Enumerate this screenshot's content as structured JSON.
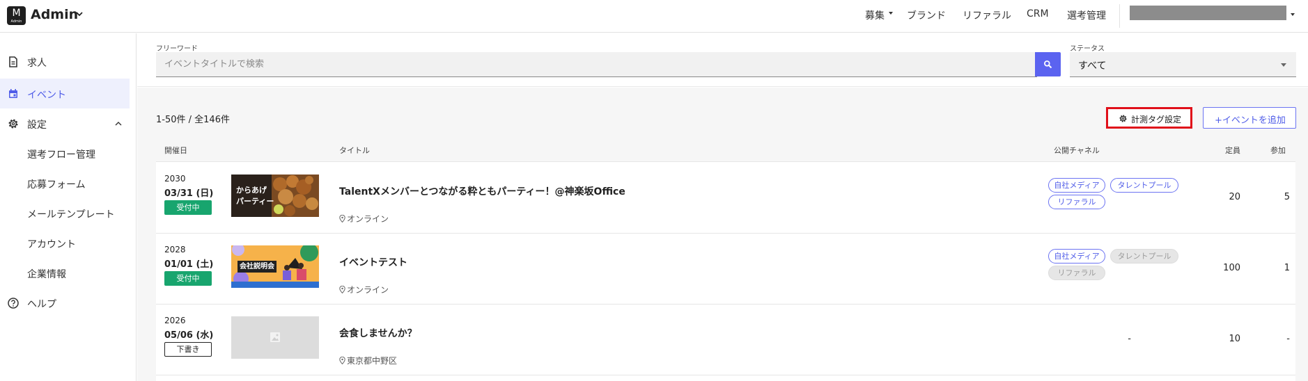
{
  "app": {
    "logo_letter": "M",
    "logo_sub": "Admin",
    "title": "Admin"
  },
  "topnav": {
    "items": [
      "募集",
      "ブランド",
      "リファラル",
      "CRM",
      "選考管理"
    ]
  },
  "sidebar": {
    "items": [
      {
        "label": "求人",
        "icon": "document-icon"
      },
      {
        "label": "イベント",
        "icon": "calendar-icon"
      },
      {
        "label": "設定",
        "icon": "gear-icon"
      }
    ],
    "sub_items": [
      "選考フロー管理",
      "応募フォーム",
      "メールテンプレート",
      "アカウント",
      "企業情報"
    ],
    "help_label": "ヘルプ"
  },
  "filters": {
    "keyword_label": "フリーワード",
    "keyword_placeholder": "イベントタイトルで検索",
    "keyword_value": "",
    "status_label": "ステータス",
    "status_value": "すべて"
  },
  "list": {
    "count_text": "1-50件 / 全146件",
    "tag_button_label": "計測タグ設定",
    "add_button_label": "+イベントを追加",
    "columns": {
      "date": "開催日",
      "title": "タイトル",
      "channel": "公開チャネル",
      "capacity": "定員",
      "participants": "参加"
    },
    "rows": [
      {
        "year": "2030",
        "date": "03/31 (日)",
        "status": "受付中",
        "thumb_text": "からあげ\nパーティー",
        "thumb_line1": "からあげ",
        "thumb_line2": "パーティー",
        "title": "TalentXメンバーとつながる粋ともパーティー！@神楽坂Office",
        "location": "オンライン",
        "channels": [
          {
            "label": "自社メディア",
            "active": true
          },
          {
            "label": "タレントプール",
            "active": true
          },
          {
            "label": "リファラル",
            "active": true
          }
        ],
        "capacity": "20",
        "participants": "5"
      },
      {
        "year": "2028",
        "date": "01/01 (土)",
        "status": "受付中",
        "thumb_line1": "会社説明会",
        "title": "イベントテスト",
        "location": "オンライン",
        "channels": [
          {
            "label": "自社メディア",
            "active": true
          },
          {
            "label": "タレントプール",
            "active": false
          },
          {
            "label": "リファラル",
            "active": false
          }
        ],
        "capacity": "100",
        "participants": "1"
      },
      {
        "year": "2026",
        "date": "05/06 (水)",
        "status": "下書き",
        "title": "会食しませんか？",
        "location": "東京都中野区",
        "channel_text": "-",
        "capacity": "10",
        "participants": "-"
      }
    ]
  },
  "colors": {
    "accent": "#5b63f0",
    "open_badge": "#18a56e",
    "highlight_border": "#e0101a"
  }
}
